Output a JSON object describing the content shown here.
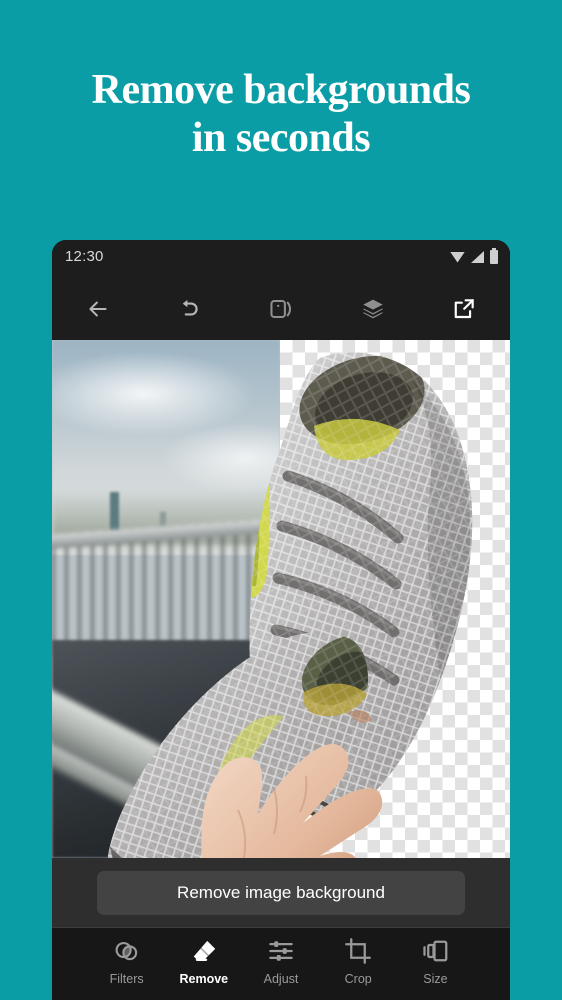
{
  "promo": {
    "headline_line1": "Remove backgrounds",
    "headline_line2": "in seconds",
    "background_color": "#0a9da5",
    "headline_color": "#ffffff"
  },
  "phone": {
    "status_bar": {
      "time": "12:30",
      "icons": [
        "wifi-icon",
        "signal-icon",
        "battery-icon"
      ]
    },
    "toolbar": {
      "items": [
        {
          "name": "back-button",
          "icon": "arrow-left-icon",
          "label": "Back"
        },
        {
          "name": "undo-button",
          "icon": "undo-icon",
          "label": "Undo"
        },
        {
          "name": "compare-button",
          "icon": "compare-icon",
          "label": "Compare"
        },
        {
          "name": "layers-button",
          "icon": "layers-icon",
          "label": "Layers"
        },
        {
          "name": "export-button",
          "icon": "export-icon",
          "label": "Export"
        }
      ]
    },
    "canvas": {
      "left_label": "original photo with blurred street background",
      "right_label": "background removed, transparent checkerboard",
      "checker_light": "#ffffff",
      "checker_dark": "#e1e1e1"
    },
    "action": {
      "button_label": "Remove image background"
    },
    "bottom_nav": {
      "items": [
        {
          "label": "Filters",
          "icon": "filters-icon",
          "active": false
        },
        {
          "label": "Remove",
          "icon": "eraser-icon",
          "active": true
        },
        {
          "label": "Adjust",
          "icon": "sliders-icon",
          "active": false
        },
        {
          "label": "Crop",
          "icon": "crop-icon",
          "active": false
        },
        {
          "label": "Size",
          "icon": "size-icon",
          "active": false
        }
      ]
    }
  }
}
